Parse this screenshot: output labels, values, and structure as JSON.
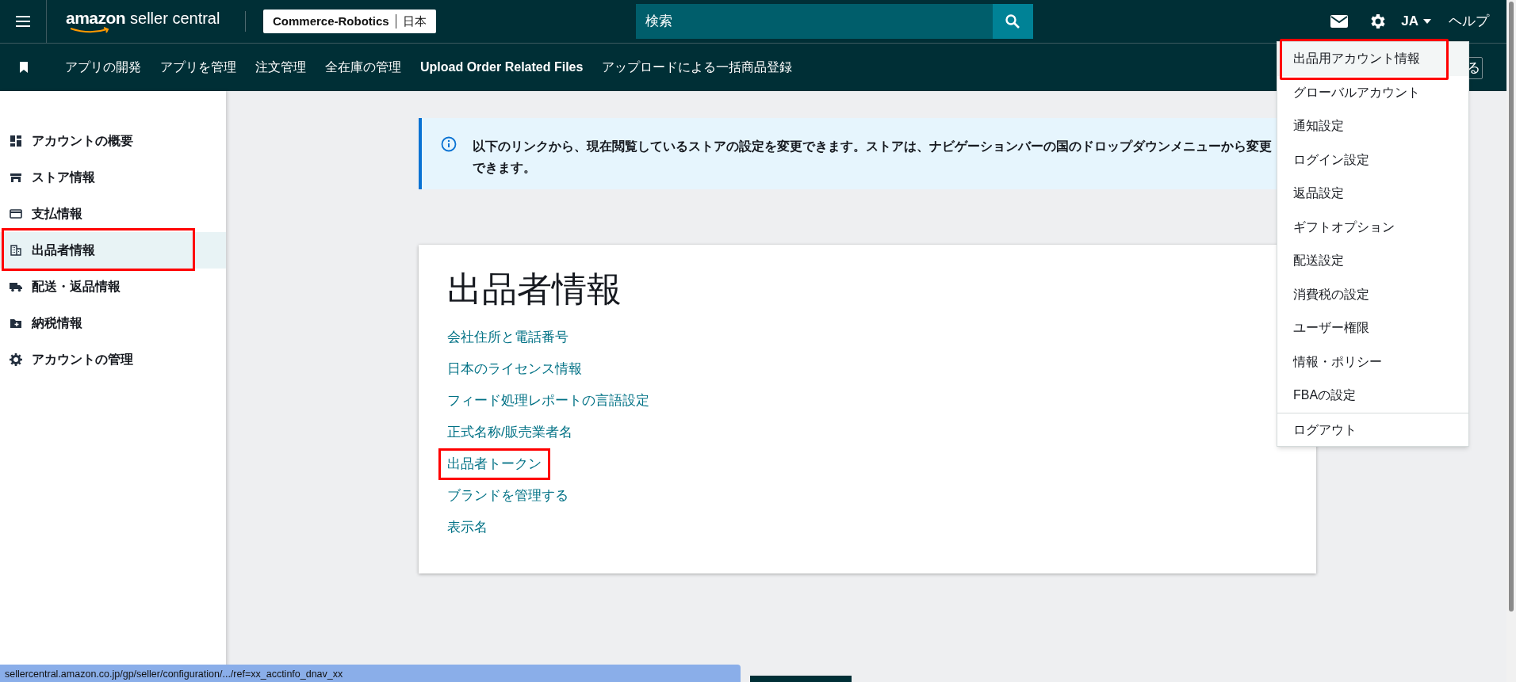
{
  "header": {
    "logo_brand": "amazon",
    "logo_product": "seller central",
    "store": "Commerce-Robotics",
    "marketplace": "日本",
    "search": {
      "placeholder": "検索"
    },
    "language": "JA",
    "help": "ヘルプ"
  },
  "nav": {
    "items": [
      "アプリの開発",
      "アプリを管理",
      "注文管理",
      "全在庫の管理",
      "Upload Order Related Files",
      "アップロードによる一括商品登録"
    ],
    "partial_button": "る"
  },
  "sidebar": {
    "items": [
      {
        "label": "アカウントの概要",
        "kind": "dashboard",
        "selected": false,
        "highlighted": false
      },
      {
        "label": "ストア情報",
        "kind": "store",
        "selected": false,
        "highlighted": false
      },
      {
        "label": "支払情報",
        "kind": "card",
        "selected": false,
        "highlighted": false
      },
      {
        "label": "出品者情報",
        "kind": "building",
        "selected": true,
        "highlighted": true
      },
      {
        "label": "配送・返品情報",
        "kind": "truck",
        "selected": false,
        "highlighted": false
      },
      {
        "label": "納税情報",
        "kind": "folder",
        "selected": false,
        "highlighted": false
      },
      {
        "label": "アカウントの管理",
        "kind": "gear",
        "selected": false,
        "highlighted": false
      }
    ]
  },
  "notice": {
    "text": "以下のリンクから、現在閲覧しているストアの設定を変更できます。ストアは、ナビゲーションバーの国のドロップダウンメニューから変更できます。"
  },
  "card": {
    "title": "出品者情報",
    "links": [
      {
        "label": "会社住所と電話番号",
        "highlighted": false
      },
      {
        "label": "日本のライセンス情報",
        "highlighted": false
      },
      {
        "label": "フィード処理レポートの言語設定",
        "highlighted": false
      },
      {
        "label": "正式名称/販売業者名",
        "highlighted": false
      },
      {
        "label": "出品者トークン",
        "highlighted": true
      },
      {
        "label": "ブランドを管理する",
        "highlighted": false
      },
      {
        "label": "表示名",
        "highlighted": false
      }
    ]
  },
  "settings_menu": {
    "items": [
      {
        "label": "出品用アカウント情報",
        "selected": true,
        "highlighted": true
      },
      {
        "label": "グローバルアカウント",
        "selected": false,
        "highlighted": false
      },
      {
        "label": "通知設定",
        "selected": false,
        "highlighted": false
      },
      {
        "label": "ログイン設定",
        "selected": false,
        "highlighted": false
      },
      {
        "label": "返品設定",
        "selected": false,
        "highlighted": false
      },
      {
        "label": "ギフトオプション",
        "selected": false,
        "highlighted": false
      },
      {
        "label": "配送設定",
        "selected": false,
        "highlighted": false
      },
      {
        "label": "消費税の設定",
        "selected": false,
        "highlighted": false
      },
      {
        "label": "ユーザー権限",
        "selected": false,
        "highlighted": false
      },
      {
        "label": "情報・ポリシー",
        "selected": false,
        "highlighted": false
      },
      {
        "label": "FBAの設定",
        "selected": false,
        "highlighted": false
      }
    ],
    "footer_item": "ログアウト"
  },
  "status_url": "sellercentral.amazon.co.jp/gp/seller/configuration/.../ref=xx_acctinfo_dnav_xx"
}
